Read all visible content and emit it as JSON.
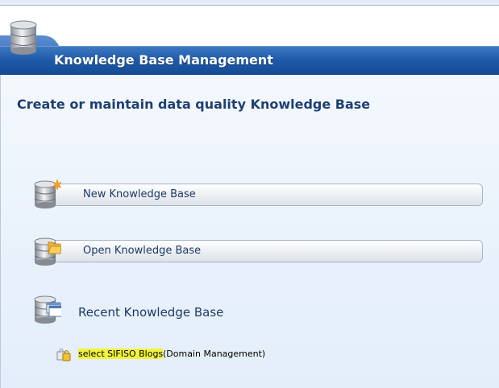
{
  "header": {
    "title": "Knowledge Base Management"
  },
  "main": {
    "subtitle": "Create or maintain data quality Knowledge Base",
    "actions": [
      {
        "label": "New Knowledge Base",
        "icon": "database-new-icon"
      },
      {
        "label": "Open Knowledge Base",
        "icon": "database-open-icon"
      }
    ],
    "recent": {
      "title": "Recent Knowledge Base",
      "items": [
        {
          "name": "select SIFISO Blogs",
          "mode": "(Domain Management)",
          "icon": "lock-icon"
        }
      ]
    }
  },
  "colors": {
    "header_blue": "#1f5aa8",
    "highlight": "#f3f33a",
    "text_dark": "#1f3a63"
  }
}
